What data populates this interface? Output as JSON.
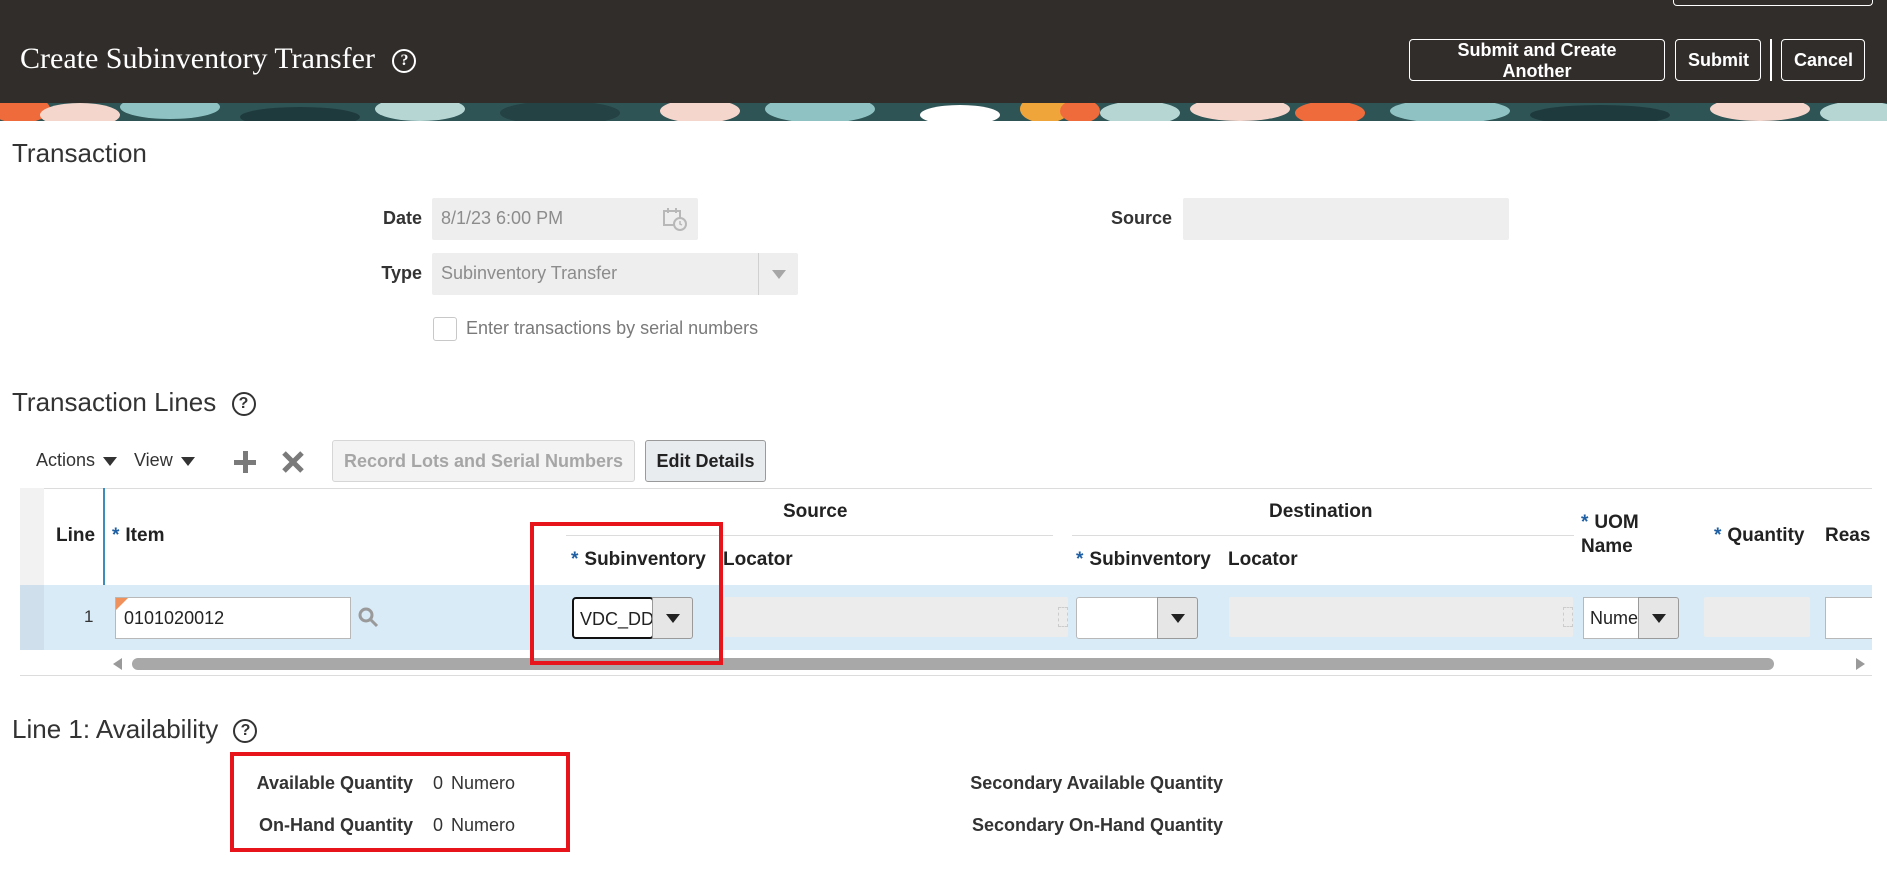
{
  "header": {
    "title": "Create Subinventory Transfer",
    "help_glyph": "?",
    "buttons": {
      "submit_another": "Submit and Create Another",
      "submit": "Submit",
      "cancel": "Cancel"
    }
  },
  "transaction": {
    "section_title": "Transaction",
    "date_label": "Date",
    "date_value": "8/1/23 6:00 PM",
    "type_label": "Type",
    "type_value": "Subinventory Transfer",
    "source_label": "Source",
    "source_value": "",
    "serial_checkbox_label": "Enter transactions by serial numbers",
    "serial_checked": false
  },
  "lines": {
    "section_title": "Transaction Lines",
    "toolbar": {
      "actions": "Actions",
      "view": "View",
      "record_lots": "Record Lots and Serial Numbers",
      "edit_details": "Edit Details"
    },
    "columns": {
      "line": "Line",
      "item": "Item",
      "source_group": "Source",
      "destination_group": "Destination",
      "source_subinventory": "Subinventory",
      "source_locator": "Locator",
      "dest_subinventory": "Subinventory",
      "dest_locator": "Locator",
      "uom_name_1": "UOM",
      "uom_name_2": "Name",
      "quantity": "Quantity",
      "reason": "Reas"
    },
    "rows": [
      {
        "line": "1",
        "item": "0101020012",
        "source_subinventory": "VDC_DD",
        "source_locator": "",
        "dest_subinventory": "",
        "dest_locator": "",
        "uom": "Nume",
        "quantity": ""
      }
    ]
  },
  "availability": {
    "section_title": "Line 1: Availability",
    "available_label": "Available Quantity",
    "available_value": "0",
    "available_uom": "Numero",
    "onhand_label": "On-Hand Quantity",
    "onhand_value": "0",
    "onhand_uom": "Numero",
    "secondary_available_label": "Secondary Available Quantity",
    "secondary_onhand_label": "Secondary On-Hand Quantity"
  },
  "colors": {
    "header_bg": "#312d2a",
    "highlight_row": "#d9ebf7",
    "annotation_red": "#e8141c",
    "required_star": "#1f5fa3"
  }
}
